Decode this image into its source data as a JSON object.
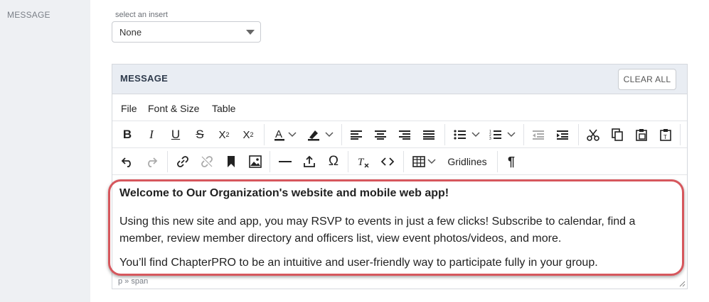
{
  "section_label": "MESSAGE",
  "insert": {
    "label": "select an insert",
    "value": "None"
  },
  "editor": {
    "title": "MESSAGE",
    "clear_all_label": "CLEAR ALL",
    "menu": [
      "File",
      "Font & Size",
      "Table"
    ],
    "gridlines_label": "Gridlines",
    "content": {
      "heading": "Welcome to Our Organization's website and mobile web app!",
      "para1": "Using this new site and app, you may RSVP to events in just a few clicks! Subscribe to calendar, find a member, review member directory and officers list, view event photos/videos, and more.",
      "para2": "You’ll find ChapterPRO to be an intuitive and user-friendly way to participate fully in your group."
    },
    "status_path": "p » span"
  },
  "colors": {
    "highlight_border": "#d6575d",
    "header_bg": "#e9edf3",
    "left_panel_bg": "#eef0f3"
  }
}
